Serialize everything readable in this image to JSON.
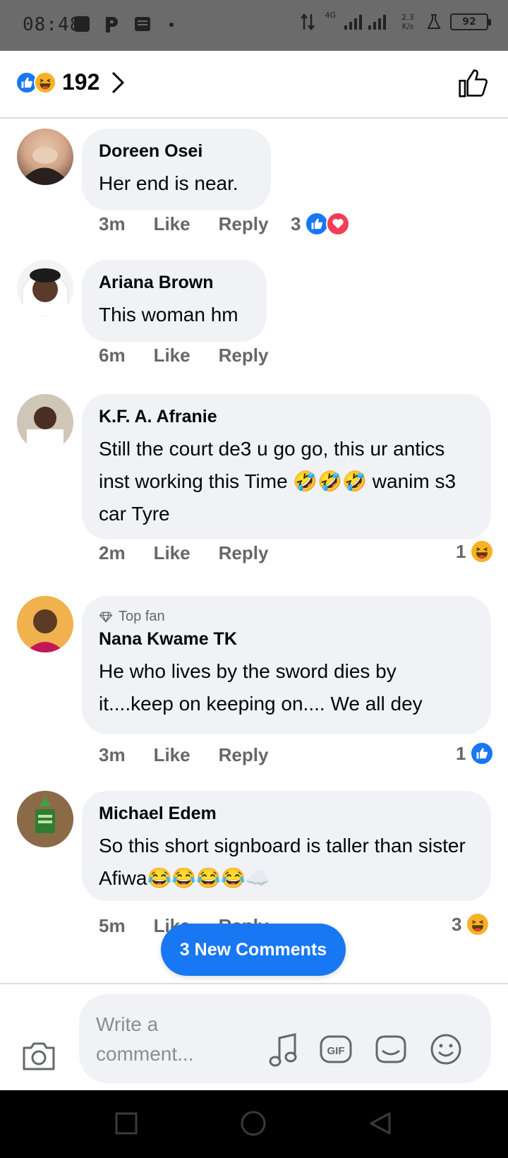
{
  "status_bar": {
    "time": "08:48",
    "network": "4G",
    "speed": "2.3 K/s",
    "battery": "92"
  },
  "header": {
    "reaction_count": "192",
    "reactions": [
      "like-icon",
      "haha-icon"
    ]
  },
  "comments": [
    {
      "author": "Doreen Osei",
      "text": "Her end is near.",
      "time": "3m",
      "like": "Like",
      "reply": "Reply",
      "reaction_count": "3",
      "reactions": [
        "like-icon",
        "love-icon"
      ]
    },
    {
      "author": "Ariana Brown",
      "text": "This woman hm",
      "time": "6m",
      "like": "Like",
      "reply": "Reply",
      "reaction_count": "",
      "reactions": []
    },
    {
      "author": "K.F. A. Afranie",
      "text": "Still the court de3 u go go, this ur antics inst working this Time 🤣🤣🤣 wanim s3 car Tyre",
      "time": "2m",
      "like": "Like",
      "reply": "Reply",
      "reaction_count": "1",
      "reactions": [
        "haha-icon"
      ]
    },
    {
      "badge": "Top fan",
      "author": "Nana Kwame TK",
      "text": "He who lives by the sword dies by it....keep on keeping on.... We all dey",
      "time": "3m",
      "like": "Like",
      "reply": "Reply",
      "reaction_count": "1",
      "reactions": [
        "like-icon"
      ]
    },
    {
      "author": "Michael Edem",
      "text": "So this short signboard is taller than sister Afiwa😂😂😂😂☁️",
      "time": "5m",
      "like": "Like",
      "reply": "Reply",
      "reaction_count": "3",
      "reactions": [
        "haha-icon"
      ]
    }
  ],
  "new_comments_label": "3 New Comments",
  "composer": {
    "placeholder": "Write a comment..."
  },
  "colors": {
    "accent": "#1877f2",
    "bubble": "#f0f2f5",
    "secondary_text": "#65676b",
    "love": "#f33e58",
    "haha": "#f7b125"
  }
}
